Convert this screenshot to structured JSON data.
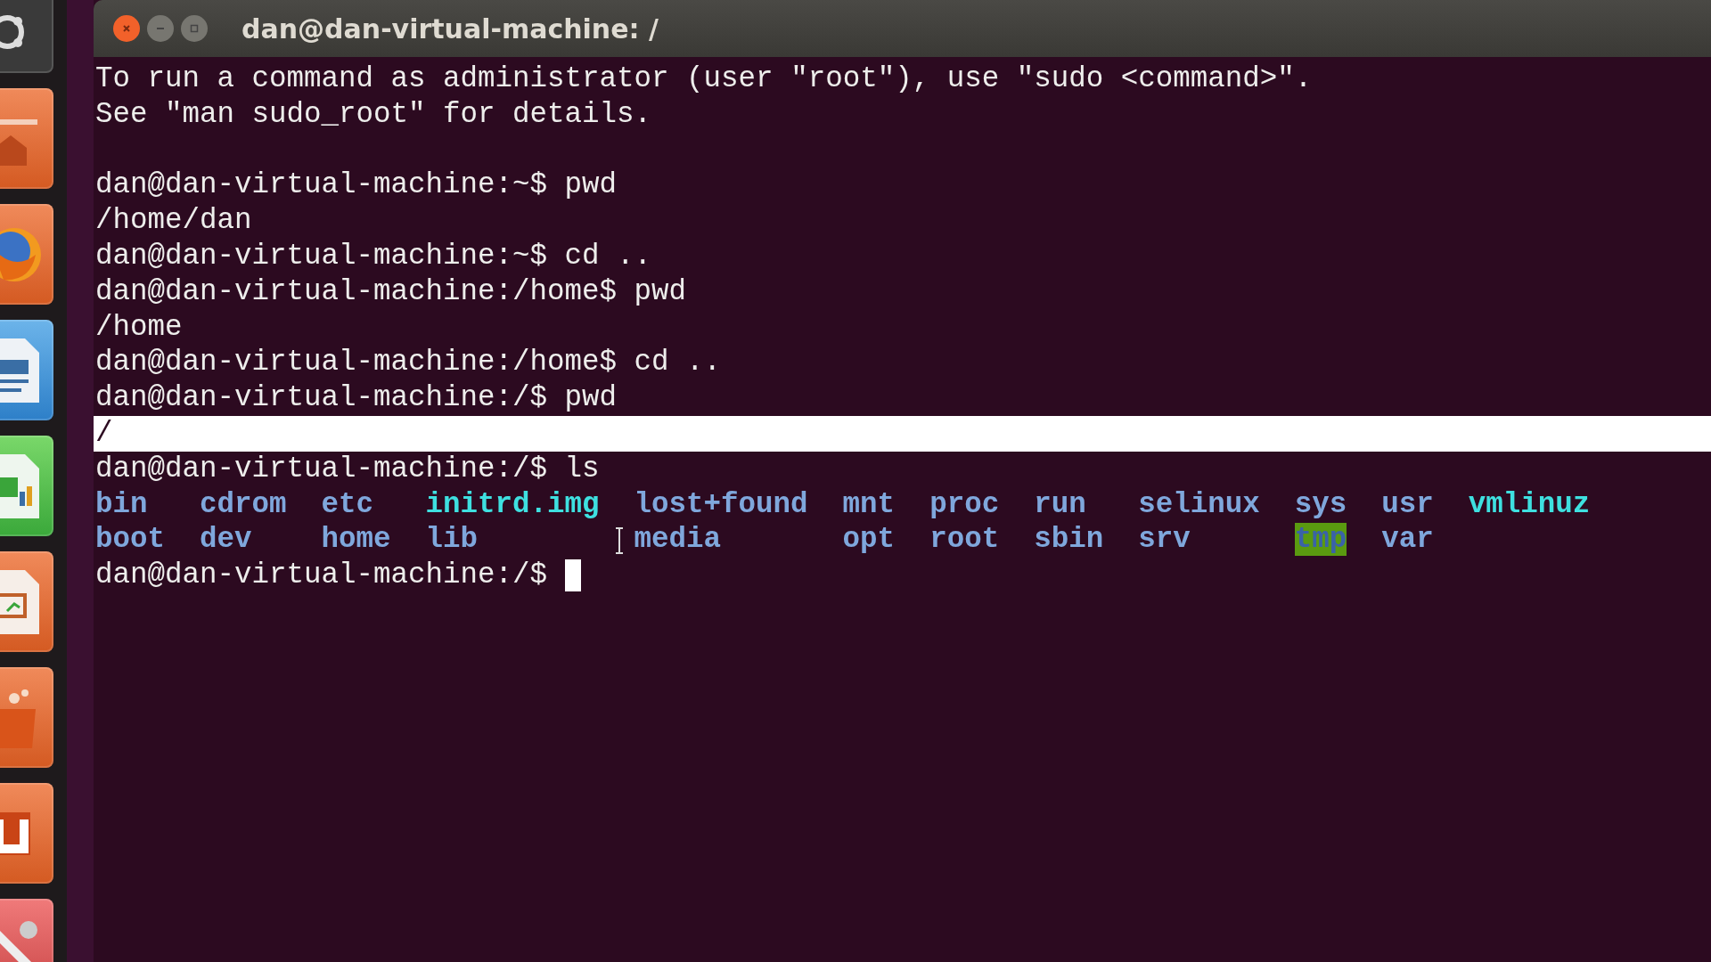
{
  "window": {
    "title": "dan@dan-virtual-machine: /"
  },
  "terminal": {
    "lines": [
      {
        "kind": "text",
        "text": "To run a command as administrator (user \"root\"), use \"sudo <command>\".",
        "selected": false
      },
      {
        "kind": "text",
        "text": "See \"man sudo_root\" for details.",
        "selected": false
      },
      {
        "kind": "blank"
      },
      {
        "kind": "text",
        "text": "dan@dan-virtual-machine:~$ pwd",
        "selected": false
      },
      {
        "kind": "text",
        "text": "/home/dan",
        "selected": false
      },
      {
        "kind": "text",
        "text": "dan@dan-virtual-machine:~$ cd ..",
        "selected": false
      },
      {
        "kind": "text",
        "text": "dan@dan-virtual-machine:/home$ pwd",
        "selected": false
      },
      {
        "kind": "text",
        "text": "/home",
        "selected": false
      },
      {
        "kind": "text",
        "text": "dan@dan-virtual-machine:/home$ cd ..",
        "selected": false
      },
      {
        "kind": "text",
        "text": "dan@dan-virtual-machine:/$ pwd",
        "selected": false
      },
      {
        "kind": "text",
        "text": "/",
        "selected": true
      },
      {
        "kind": "text",
        "text": "dan@dan-virtual-machine:/$ ls",
        "selected": false
      }
    ],
    "listing": [
      [
        {
          "name": "bin",
          "kind": "dir"
        },
        {
          "name": "cdrom",
          "kind": "dir"
        },
        {
          "name": "etc",
          "kind": "dir"
        },
        {
          "name": "initrd.img",
          "kind": "link"
        },
        {
          "name": "lost+found",
          "kind": "dir"
        },
        {
          "name": "mnt",
          "kind": "dir"
        },
        {
          "name": "proc",
          "kind": "dir"
        },
        {
          "name": "run",
          "kind": "dir"
        },
        {
          "name": "selinux",
          "kind": "dir"
        },
        {
          "name": "sys",
          "kind": "dir"
        },
        {
          "name": "usr",
          "kind": "dir"
        },
        {
          "name": "vmlinuz",
          "kind": "link"
        }
      ],
      [
        {
          "name": "boot",
          "kind": "dir"
        },
        {
          "name": "dev",
          "kind": "dir"
        },
        {
          "name": "home",
          "kind": "dir"
        },
        {
          "name": "lib",
          "kind": "dir"
        },
        {
          "name": "media",
          "kind": "dir"
        },
        {
          "name": "opt",
          "kind": "dir"
        },
        {
          "name": "root",
          "kind": "dir"
        },
        {
          "name": "sbin",
          "kind": "dir"
        },
        {
          "name": "srv",
          "kind": "dir"
        },
        {
          "name": "tmp",
          "kind": "sticky"
        },
        {
          "name": "var",
          "kind": "dir"
        }
      ]
    ],
    "prompt": {
      "text": "dan@dan-virtual-machine:/$",
      "cursor": true
    }
  }
}
